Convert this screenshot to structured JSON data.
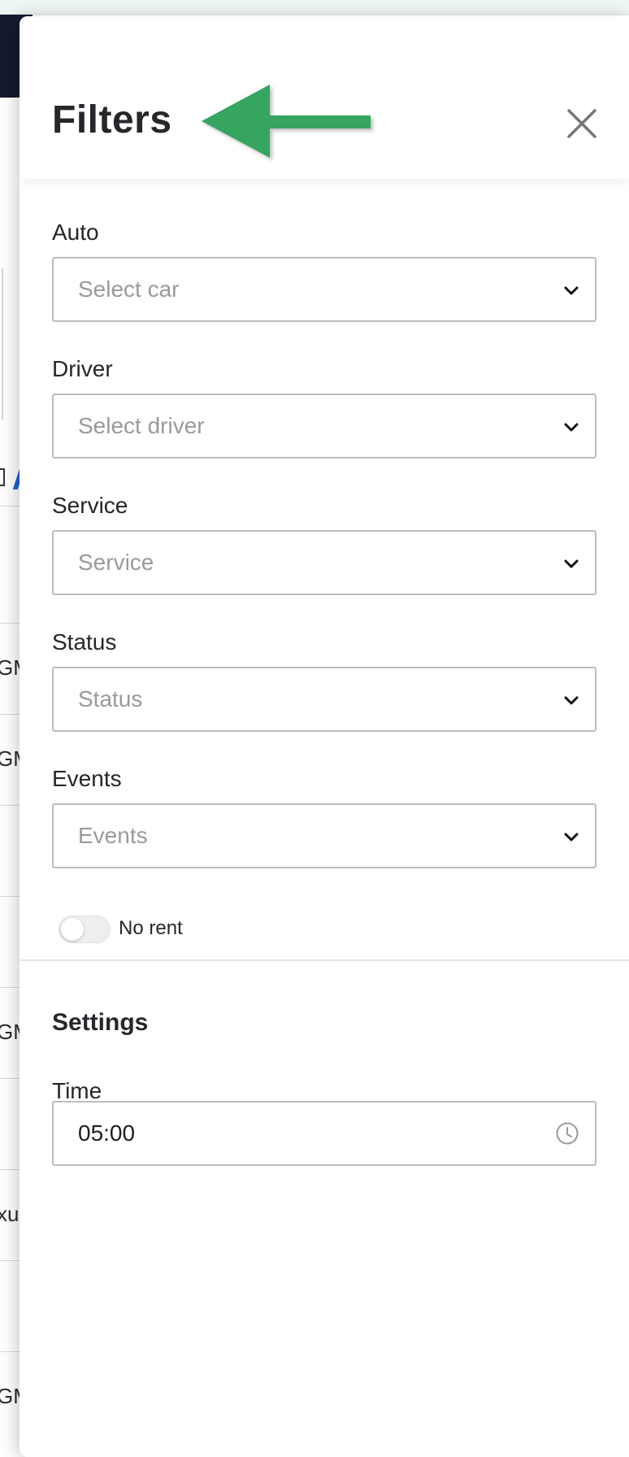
{
  "background": {
    "row_fragments": [
      "GM",
      "GM",
      "GM",
      "xu",
      "GM"
    ]
  },
  "drawer": {
    "title": "Filters",
    "close_icon": "close-icon",
    "annotation": "green-arrow-pointing-left"
  },
  "filters": {
    "auto": {
      "label": "Auto",
      "placeholder": "Select car"
    },
    "driver": {
      "label": "Driver",
      "placeholder": "Select driver"
    },
    "service": {
      "label": "Service",
      "placeholder": "Service"
    },
    "status": {
      "label": "Status",
      "placeholder": "Status"
    },
    "events": {
      "label": "Events",
      "placeholder": "Events"
    },
    "no_rent": {
      "label": "No rent",
      "enabled": false
    }
  },
  "settings": {
    "title": "Settings",
    "time": {
      "label": "Time",
      "value": "05:00",
      "icon": "clock-icon"
    }
  },
  "colors": {
    "arrow_green": "#34a561",
    "nav_dark": "#151a2e",
    "border_gray": "#bdbdbd"
  }
}
